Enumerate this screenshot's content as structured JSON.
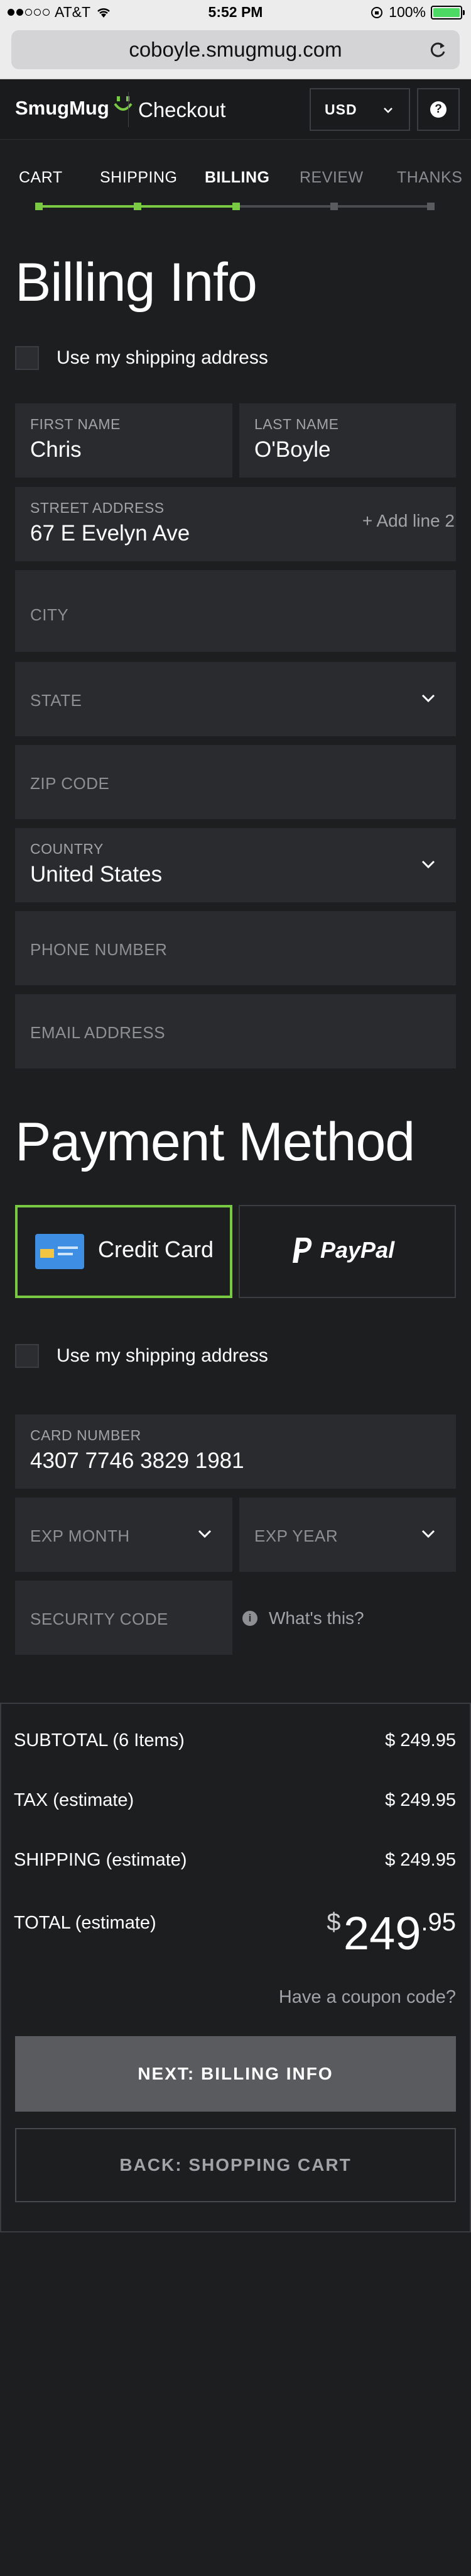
{
  "status_bar": {
    "carrier": "AT&T",
    "time": "5:52 PM",
    "battery": "100%"
  },
  "browser": {
    "url": "coboyle.smugmug.com"
  },
  "header": {
    "logo": "SmugMug",
    "title": "Checkout",
    "currency": "USD"
  },
  "steps": [
    {
      "label": "CART",
      "state": "done"
    },
    {
      "label": "SHIPPING",
      "state": "done"
    },
    {
      "label": "BILLING",
      "state": "active"
    },
    {
      "label": "REVIEW",
      "state": "pending"
    },
    {
      "label": "THANKS",
      "state": "pending"
    }
  ],
  "billing": {
    "heading": "Billing Info",
    "use_shipping_label": "Use my shipping address",
    "first_name": {
      "label": "FIRST NAME",
      "value": "Chris"
    },
    "last_name": {
      "label": "LAST NAME",
      "value": "O'Boyle"
    },
    "street": {
      "label": "STREET ADDRESS",
      "value": "67 E Evelyn Ave",
      "add_line": "+ Add line 2"
    },
    "city": {
      "placeholder": "CITY"
    },
    "state": {
      "placeholder": "STATE"
    },
    "zip": {
      "placeholder": "ZIP CODE"
    },
    "country": {
      "label": "COUNTRY",
      "value": "United States"
    },
    "phone": {
      "placeholder": "PHONE NUMBER"
    },
    "email": {
      "placeholder": "EMAIL ADDRESS"
    }
  },
  "payment": {
    "heading": "Payment Method",
    "credit_card_label": "Credit Card",
    "paypal_label": "PayPal",
    "use_shipping_label": "Use my shipping address",
    "card_number": {
      "label": "CARD NUMBER",
      "value": "4307 7746 3829 1981"
    },
    "exp_month": {
      "placeholder": "EXP MONTH"
    },
    "exp_year": {
      "placeholder": "EXP YEAR"
    },
    "security_code": {
      "placeholder": "SECURITY CODE"
    },
    "whats_this": "What's this?"
  },
  "summary": {
    "subtotal_label": "SUBTOTAL (6 Items)",
    "subtotal_value": "$ 249.95",
    "tax_label": "TAX (estimate)",
    "tax_value": "$ 249.95",
    "shipping_label": "SHIPPING (estimate)",
    "shipping_value": "$ 249.95",
    "total_label": "TOTAL (estimate)",
    "total_currency": "$",
    "total_whole": "249",
    "total_cents": ".95",
    "coupon_link": "Have a coupon code?",
    "next_button": "NEXT: BILLING INFO",
    "back_button": "BACK: SHOPPING CART"
  },
  "colors": {
    "accent": "#7ac943",
    "background": "#1d1e20",
    "field": "#2a2b2e"
  }
}
